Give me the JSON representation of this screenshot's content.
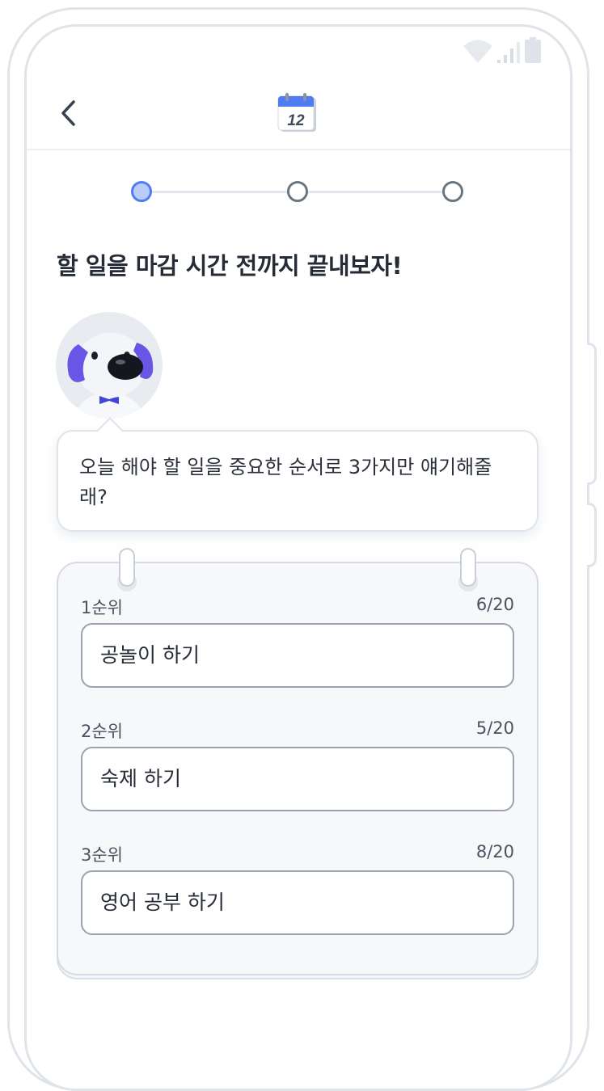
{
  "header": {
    "back_icon": "chevron-left-icon",
    "calendar_icon": "calendar-icon",
    "calendar_day": "12"
  },
  "status_bar": {
    "icons": [
      "wifi-icon",
      "signal-icon",
      "battery-icon"
    ]
  },
  "stepper": {
    "steps": 3,
    "active_step": 1
  },
  "headline": "할 일을 마감 시간 전까지 끝내보자!",
  "bubble": {
    "message": "오늘 해야 할 일을 중요한 순서로 3가지만 얘기해줄래?"
  },
  "tasks": [
    {
      "label": "1순위",
      "count": "6/20",
      "value": "공놀이 하기"
    },
    {
      "label": "2순위",
      "count": "5/20",
      "value": "숙제 하기"
    },
    {
      "label": "3순위",
      "count": "8/20",
      "value": "영어 공부 하기"
    }
  ],
  "colors": {
    "accent": "#4f7cf2",
    "accent_light": "#b9cdfb",
    "text": "#262c36",
    "border": "#dfe3ea"
  }
}
